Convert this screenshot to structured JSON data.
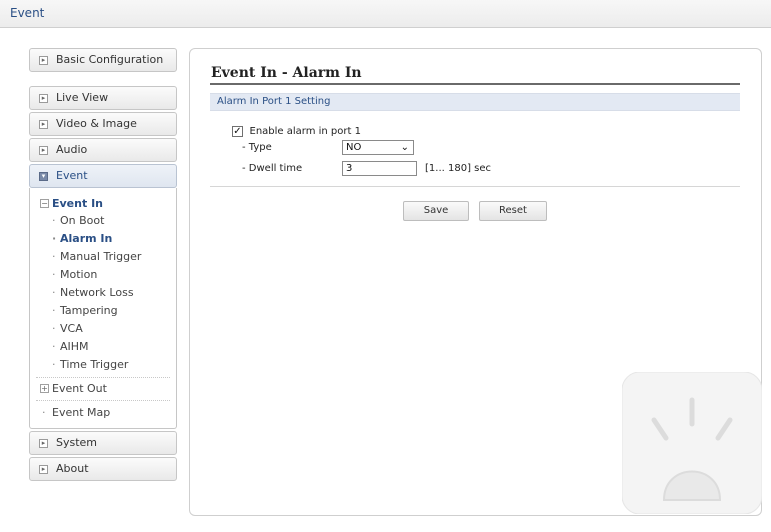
{
  "topbar": {
    "title": "Event"
  },
  "sidebar": {
    "basic_configuration": "Basic Configuration",
    "live_view": "Live View",
    "video_image": "Video & Image",
    "audio": "Audio",
    "event": "Event",
    "event_sub": {
      "event_in": "Event In",
      "items": [
        "On Boot",
        "Alarm In",
        "Manual Trigger",
        "Motion",
        "Network Loss",
        "Tampering",
        "VCA",
        "AIHM",
        "Time Trigger"
      ],
      "event_out": "Event Out",
      "event_map": "Event Map"
    },
    "system": "System",
    "about": "About"
  },
  "main": {
    "page_title": "Event In - Alarm In",
    "section_title": "Alarm In Port 1 Setting",
    "enable_label": "Enable alarm in port 1",
    "enable_checked": "✓",
    "type_label": "- Type",
    "type_value": "NO",
    "dwell_label": "- Dwell time",
    "dwell_value": "3",
    "dwell_range": "[1... 180] sec",
    "save_label": "Save",
    "reset_label": "Reset"
  },
  "icons": {
    "collapsed_box": "⊡",
    "siren": "siren-icon"
  }
}
